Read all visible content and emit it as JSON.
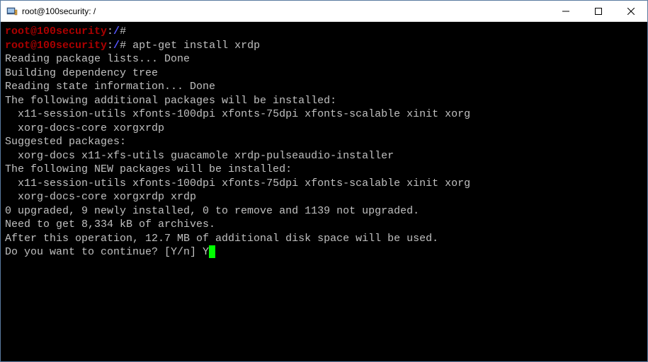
{
  "window": {
    "title": "root@100security: /"
  },
  "terminal": {
    "prompt1": {
      "user": "root@100security",
      "path": "/",
      "symbol": "#",
      "command": ""
    },
    "prompt2": {
      "user": "root@100security",
      "path": "/",
      "symbol": "#",
      "command": "apt-get install xrdp"
    },
    "output_lines": [
      "Reading package lists... Done",
      "Building dependency tree",
      "Reading state information... Done",
      "The following additional packages will be installed:",
      "  x11-session-utils xfonts-100dpi xfonts-75dpi xfonts-scalable xinit xorg",
      "  xorg-docs-core xorgxrdp",
      "Suggested packages:",
      "  xorg-docs x11-xfs-utils guacamole xrdp-pulseaudio-installer",
      "The following NEW packages will be installed:",
      "  x11-session-utils xfonts-100dpi xfonts-75dpi xfonts-scalable xinit xorg",
      "  xorg-docs-core xorgxrdp xrdp",
      "0 upgraded, 9 newly installed, 0 to remove and 1139 not upgraded.",
      "Need to get 8,334 kB of archives.",
      "After this operation, 12.7 MB of additional disk space will be used."
    ],
    "continue_prompt": "Do you want to continue? [Y/n] ",
    "user_input": "Y"
  }
}
